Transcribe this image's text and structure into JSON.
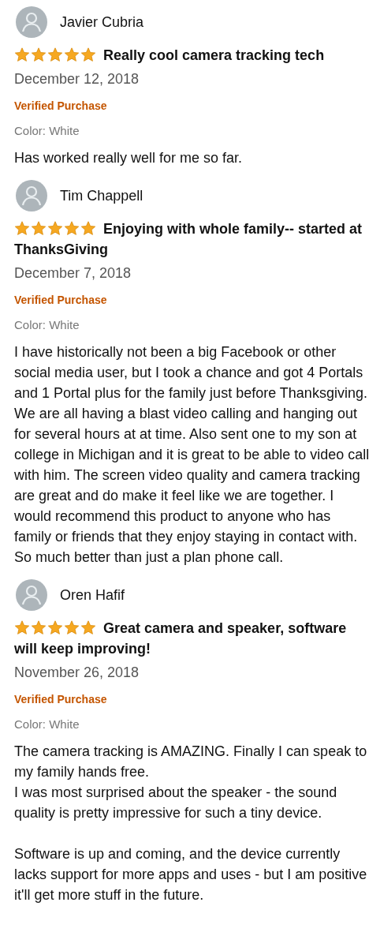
{
  "reviews": [
    {
      "name": "Javier Cubria",
      "stars": 5,
      "title": "Really cool camera tracking tech",
      "date": "December 12, 2018",
      "badge": "Verified Purchase",
      "variant": "Color: White",
      "paragraphs": [
        [
          "Has worked really well for me so far."
        ]
      ]
    },
    {
      "name": "Tim Chappell",
      "stars": 5,
      "title": "Enjoying with whole family-- started at ThanksGiving",
      "date": "December 7, 2018",
      "badge": "Verified Purchase",
      "variant": "Color: White",
      "paragraphs": [
        [
          "I have historically not been a big Facebook or other social media user, but I took a chance and got 4 Portals and 1 Portal plus for the family just before Thanksgiving. We are all having a blast video calling and hanging out for several hours at at time. Also sent one to my son at college in Michigan and it is great to be able to video call with him. The screen video quality and camera tracking are great and do make it feel like we are together. I would recommend this product to anyone who has family or friends that they enjoy staying in contact with. So much better than just a plan phone call."
        ]
      ]
    },
    {
      "name": "Oren Hafif",
      "stars": 5,
      "title": "Great camera and speaker, software will keep improving!",
      "date": "November 26, 2018",
      "badge": "Verified Purchase",
      "variant": "Color: White",
      "paragraphs": [
        [
          "The camera tracking is AMAZING. Finally I can speak to my family hands free.",
          "I was most surprised about the speaker - the sound quality is pretty impressive for such a tiny device."
        ],
        [
          "Software is up and coming, and the device currently lacks support for more apps and uses - but I am positive it'll get more stuff in the future."
        ]
      ]
    }
  ]
}
